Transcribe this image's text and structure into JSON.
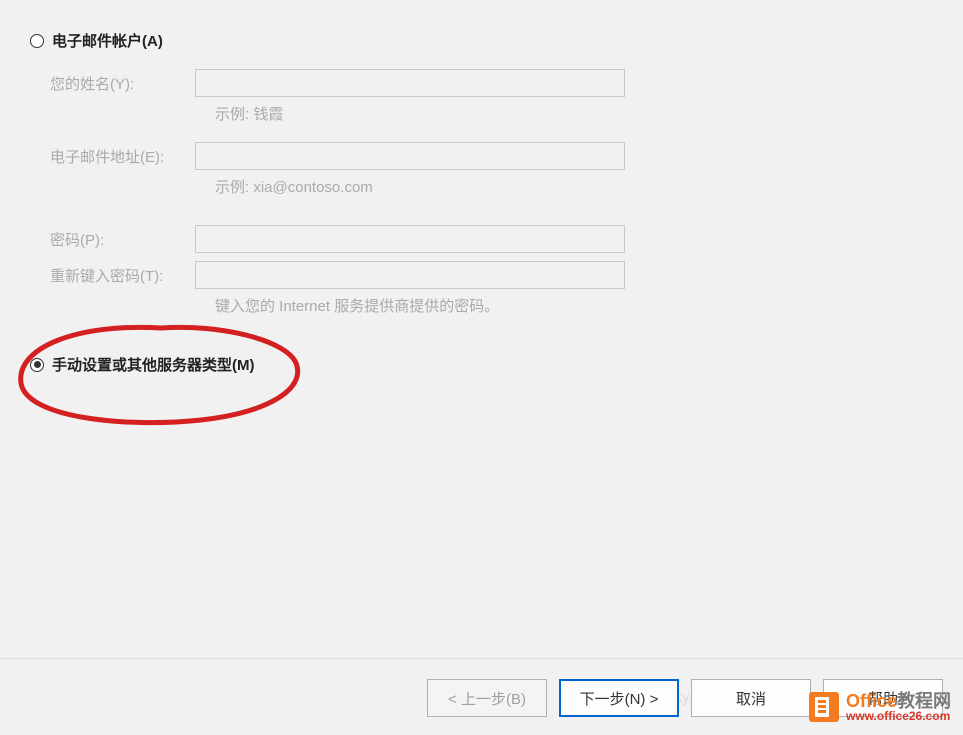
{
  "options": {
    "email_account": {
      "label": "电子邮件帐户(A)",
      "selected": false
    },
    "manual_setup": {
      "label": "手动设置或其他服务器类型(M)",
      "selected": true
    }
  },
  "form": {
    "name": {
      "label": "您的姓名(Y):",
      "value": "",
      "hint": "示例: 钱霞"
    },
    "email": {
      "label": "电子邮件地址(E):",
      "value": "",
      "hint": "示例: xia@contoso.com"
    },
    "password": {
      "label": "密码(P):",
      "value": ""
    },
    "retype_password": {
      "label": "重新键入密码(T):",
      "value": "",
      "hint": "键入您的 Internet 服务提供商提供的密码。"
    }
  },
  "buttons": {
    "back": "< 上一步(B)",
    "next": "下一步(N) >",
    "cancel": "取消",
    "help": "帮助"
  },
  "watermark": {
    "faint": "https://lipky.blog.csdn.net",
    "brand_orange": "Office",
    "brand_gray": "教程网",
    "url": "www.office26.com"
  }
}
